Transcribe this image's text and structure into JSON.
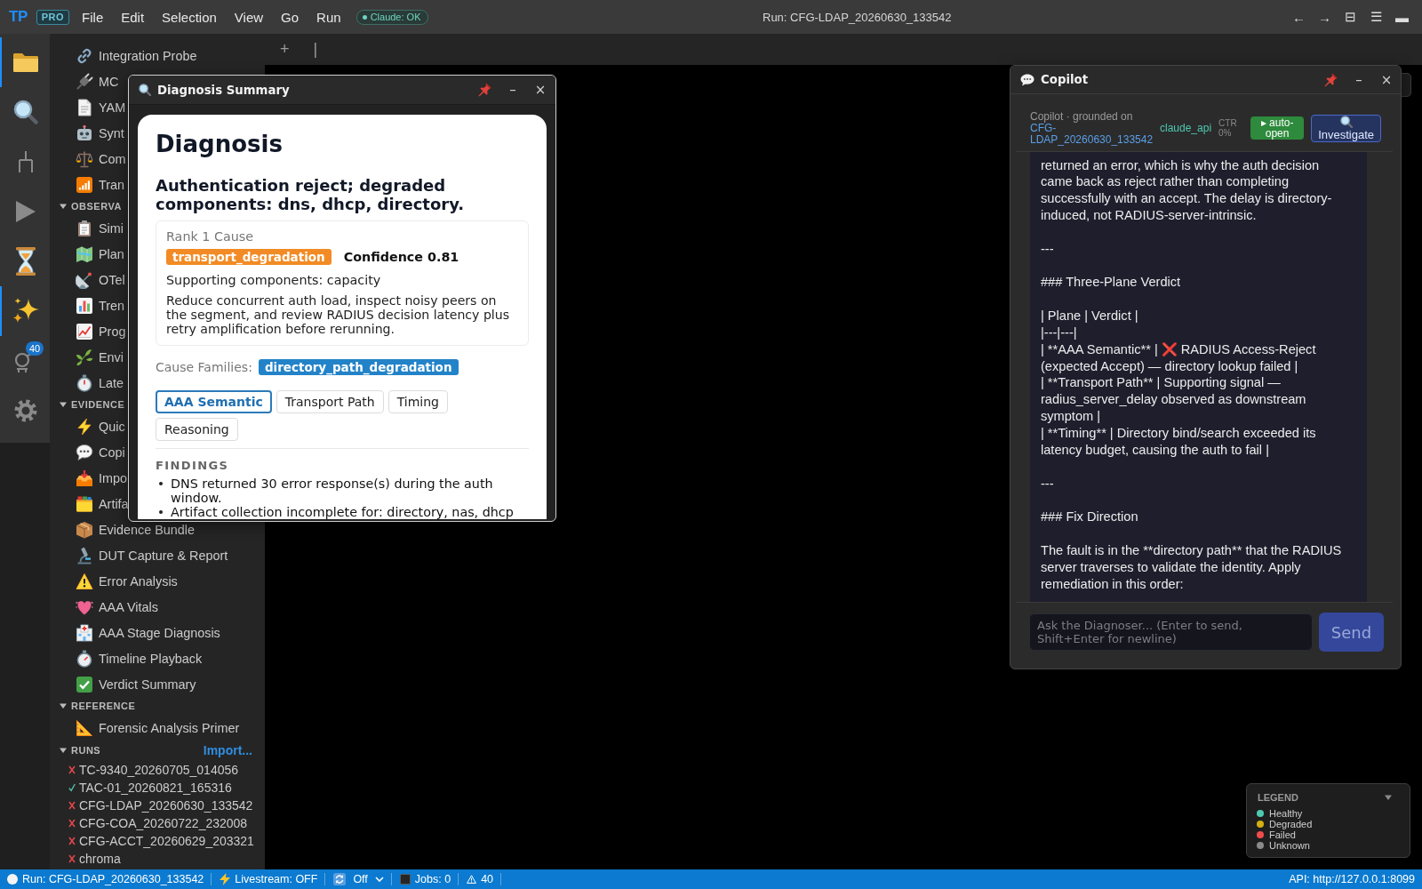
{
  "topbar": {
    "logo": "TP",
    "badge": "PRO",
    "menus": [
      "File",
      "Edit",
      "Selection",
      "View",
      "Go",
      "Run"
    ],
    "status_pill": "Claude: OK",
    "title": "Run: CFG-LDAP_20260630_133542",
    "controls": [
      "←",
      "→",
      "⊟",
      "☰",
      "▬"
    ]
  },
  "activity_bar": [
    {
      "kind": "folder",
      "selected": true
    },
    {
      "kind": "search",
      "selected": false
    },
    {
      "kind": "branch",
      "selected": false
    },
    {
      "kind": "run",
      "selected": false
    },
    {
      "kind": "hourglass",
      "selected": false
    },
    {
      "kind": "sparkles",
      "selected": true
    },
    {
      "kind": "flask",
      "selected": false,
      "badge": "40"
    },
    {
      "kind": "settings",
      "selected": false
    }
  ],
  "sidebar": {
    "sections": [
      {
        "items": [
          {
            "label": "Integration Probe"
          },
          {
            "label": "MC"
          },
          {
            "label": "YAM"
          },
          {
            "label": "Synt"
          },
          {
            "label": "Com"
          },
          {
            "label": "Tran"
          }
        ]
      },
      {
        "title": "OBSERVA",
        "expanded": true,
        "items": [
          {
            "label": "Simi"
          },
          {
            "label": "Plan"
          },
          {
            "label": "OTel"
          },
          {
            "label": "Tren"
          },
          {
            "label": "Prog"
          },
          {
            "label": "Envi"
          },
          {
            "label": "Late"
          }
        ]
      },
      {
        "title": "EVIDENCE",
        "expanded": true,
        "items": [
          {
            "label": "Quic"
          },
          {
            "label": "Copi"
          },
          {
            "label": "Impo"
          },
          {
            "label": "Artifa"
          },
          {
            "label": "Evidence Bundle"
          },
          {
            "label": "DUT Capture & Report"
          },
          {
            "label": "Error Analysis"
          },
          {
            "label": "AAA Vitals"
          },
          {
            "label": "AAA Stage Diagnosis"
          },
          {
            "label": "Timeline Playback"
          },
          {
            "label": "Verdict Summary"
          }
        ]
      },
      {
        "title": "REFERENCE",
        "expanded": true,
        "items": [
          {
            "label": "Forensic Analysis Primer"
          }
        ]
      }
    ],
    "runs": {
      "title": "RUNS",
      "expanded": true,
      "action": "Import...",
      "items": [
        {
          "name": "TC-9340_20260705_014056",
          "passed": false
        },
        {
          "name": "TAC-01_20260821_165316",
          "passed": true
        },
        {
          "name": "CFG-LDAP_20260630_133542",
          "passed": false
        },
        {
          "name": "CFG-COA_20260722_232008",
          "passed": false
        },
        {
          "name": "CFG-ACCT_20260629_203321",
          "passed": false
        },
        {
          "name": "chroma",
          "passed": false
        }
      ]
    }
  },
  "editor": {
    "tab_actions": [
      "+",
      "|"
    ]
  },
  "diagnosis_window": {
    "title": "Diagnosis Summary",
    "controls": [
      "–",
      "×"
    ],
    "heading": "Diagnosis",
    "summary": "Authentication reject; degraded components: dns, dhcp, directory.",
    "rank_card": {
      "label": "Rank 1 Cause",
      "cause": "transport_degradation",
      "confidence": "Confidence 0.81",
      "supporting": "Supporting components: capacity",
      "recommendation": "Reduce concurrent auth load, inspect noisy peers on the segment, and review RADIUS decision latency plus retry amplification before rerunning."
    },
    "cause_families": {
      "label": "Cause Families:",
      "tags": [
        "directory_path_degradation"
      ]
    },
    "tabs": [
      {
        "label": "AAA Semantic",
        "selected": true
      },
      {
        "label": "Transport Path",
        "selected": false
      },
      {
        "label": "Timing",
        "selected": false
      },
      {
        "label": "Reasoning",
        "selected": false
      }
    ],
    "findings": {
      "title": "FINDINGS",
      "items": [
        "DNS returned 30 error response(s) during the auth window.",
        "Artifact collection incomplete for: directory, nas, dhcp"
      ]
    }
  },
  "copilot_window": {
    "title": "Copilot",
    "controls": [
      "–",
      "×"
    ],
    "grounding": {
      "label": "Copilot · grounded on",
      "run": "CFG-LDAP_20260630_133542"
    },
    "model": "claude_api",
    "ctr": "CTR 0%",
    "auto_open": {
      "label": "▸ auto-open",
      "on": true
    },
    "investigate": "Investigate",
    "transcript": [
      [
        "returned an error, which is why the auth decision came back as reject rather than completing successfully with an accept. The delay is directory-induced, not RADIUS-server-intrinsic."
      ],
      [
        "---"
      ],
      [
        "### Three-Plane Verdict"
      ],
      [
        "| Plane | Verdict |",
        "|---|---|",
        "| **AAA Semantic** | ❌ RADIUS Access-Reject (expected Accept) — directory lookup failed |",
        "| **Transport Path** | Supporting signal — radius_server_delay observed as downstream symptom |",
        "| **Timing** | Directory bind/search exceeded its latency budget, causing the auth to fail |"
      ],
      [
        "---"
      ],
      [
        "### Fix Direction"
      ],
      [
        "The fault is in the **directory path** that the RADIUS server traverses to validate the identity. Apply remediation in this order:"
      ]
    ],
    "input": {
      "placeholder": "Ask the Diagnoser... (Enter to send, Shift+Enter for newline)"
    },
    "send": {
      "label": "Send",
      "disabled": true
    }
  },
  "legend": {
    "title": "LEGEND",
    "expanded": true,
    "items": [
      {
        "label": "Healthy",
        "color": "#4ec9b0"
      },
      {
        "label": "Degraded",
        "color": "#d4b012"
      },
      {
        "label": "Failed",
        "color": "#f14c4c"
      },
      {
        "label": "Unknown",
        "color": "#8a8a8a"
      }
    ]
  },
  "status_bar": {
    "items": [
      {
        "kind": "run",
        "text": "Run: CFG-LDAP_20260630_133542"
      },
      {
        "kind": "livestream",
        "text": "Livestream: OFF"
      },
      {
        "kind": "sync",
        "text": "Off"
      },
      {
        "kind": "jobs",
        "text": "Jobs: 0"
      },
      {
        "kind": "warnings",
        "text": "40"
      }
    ],
    "api": "API: http://127.0.0.1:8099"
  }
}
